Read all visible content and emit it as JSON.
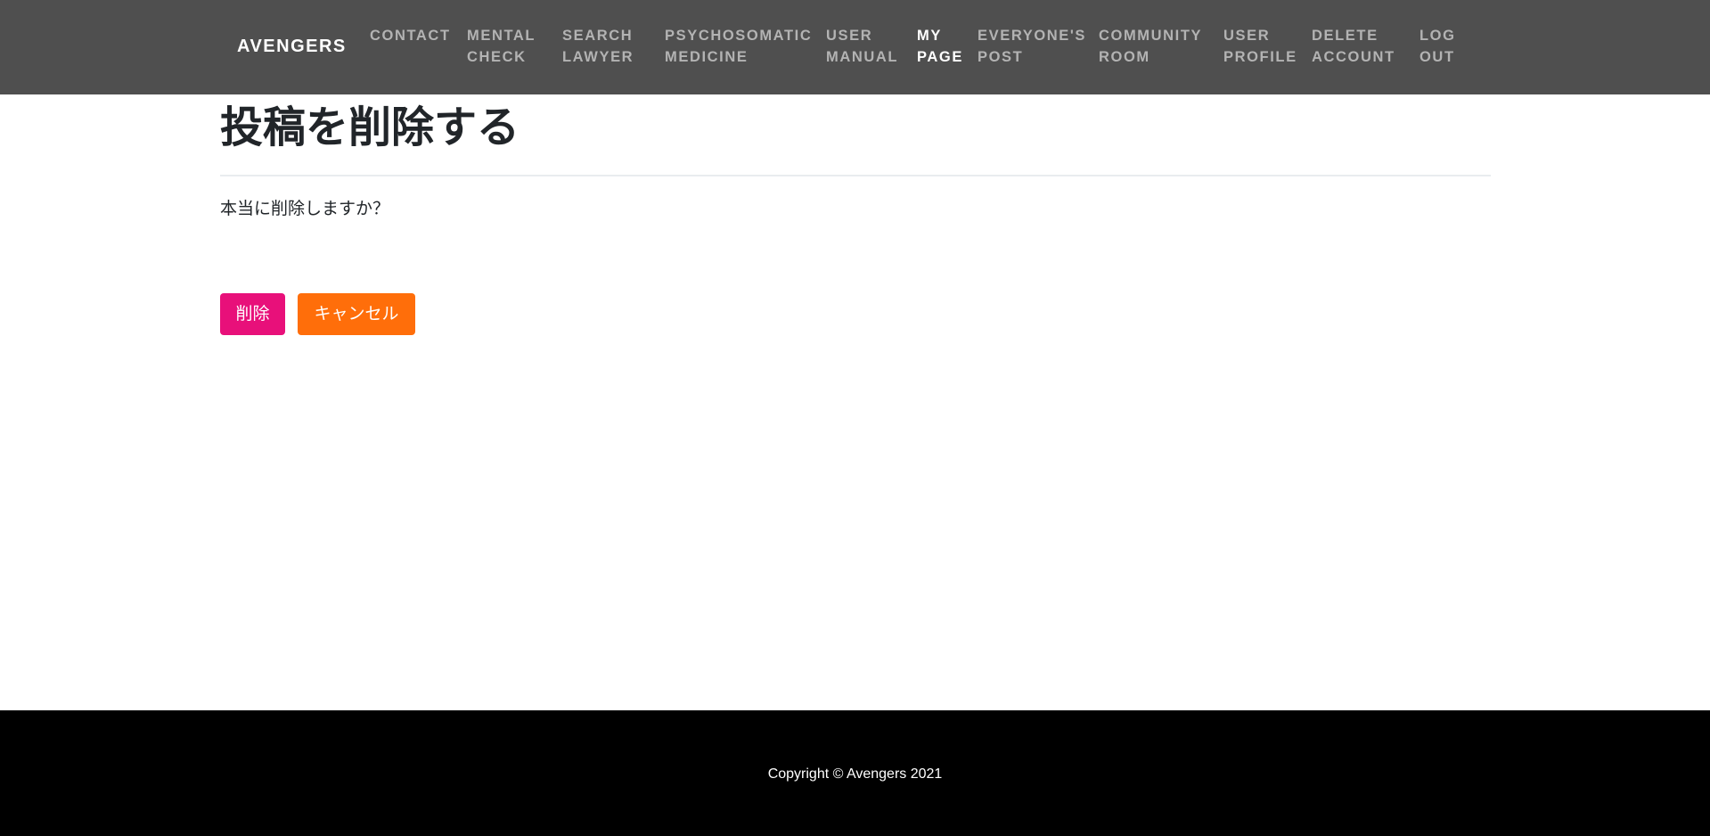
{
  "navbar": {
    "brand": "AVENGERS",
    "items": [
      {
        "id": "contact",
        "line1": "CONTACT",
        "line2": "",
        "active": false
      },
      {
        "id": "mental-check",
        "line1": "MENTAL",
        "line2": "CHECK",
        "active": false
      },
      {
        "id": "search-lawyer",
        "line1": "SEARCH",
        "line2": "LAWYER",
        "active": false
      },
      {
        "id": "psychosomatic-medicine",
        "line1": "PSYCHOSOMATIC",
        "line2": "MEDICINE",
        "active": false
      },
      {
        "id": "user-manual",
        "line1": "USER",
        "line2": "MANUAL",
        "active": false
      },
      {
        "id": "my-page",
        "line1": "MY",
        "line2": "PAGE",
        "active": true
      },
      {
        "id": "everyones-post",
        "line1": "EVERYONE'S",
        "line2": "POST",
        "active": false
      },
      {
        "id": "community-room",
        "line1": "COMMUNITY",
        "line2": "ROOM",
        "active": false
      },
      {
        "id": "user-profile",
        "line1": "USER",
        "line2": "PROFILE",
        "active": false
      },
      {
        "id": "delete-account",
        "line1": "DELETE",
        "line2": "ACCOUNT",
        "active": false
      },
      {
        "id": "log-out",
        "line1": "LOG",
        "line2": "OUT",
        "active": false
      }
    ]
  },
  "main": {
    "title": "投稿を削除する",
    "confirm_text": "本当に削除しますか？",
    "delete_label": "削除",
    "cancel_label": "キャンセル"
  },
  "footer": {
    "copyright": "Copyright © Avengers 2021"
  },
  "colors": {
    "navbar_bg": "#4f4f4f",
    "nav_text": "#b3b3b3",
    "nav_active": "#ffffff",
    "delete_button": "#e8107a",
    "cancel_button": "#ff6e0a",
    "footer_bg": "#000000"
  }
}
